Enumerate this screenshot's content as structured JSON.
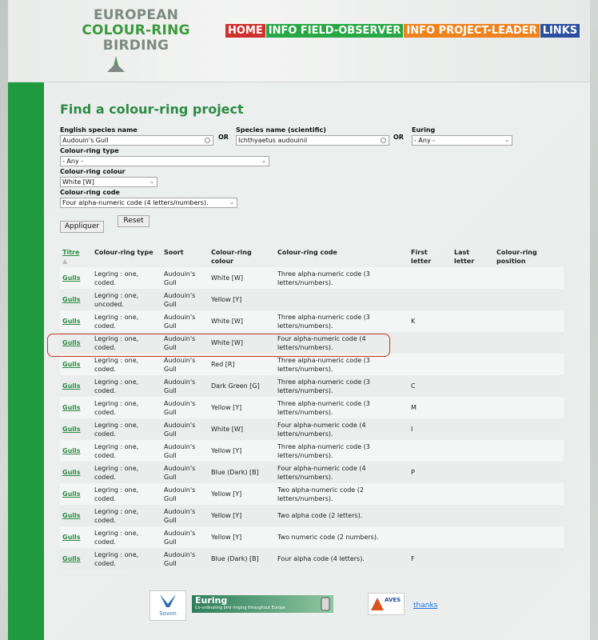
{
  "logo": {
    "line1": "EUROPEAN",
    "line2": "COLOUR-RING",
    "line3": "BIRDING"
  },
  "nav": [
    {
      "label": "HOME",
      "color": "#d0312d"
    },
    {
      "label": "INFO FIELD-OBSERVER",
      "color": "#28a745"
    },
    {
      "label": "INFO PROJECT-LEADER",
      "color": "#f0821e"
    },
    {
      "label": "LINKS",
      "color": "#2b4fa0"
    }
  ],
  "page_title": "Find a colour-ring project",
  "form": {
    "english_label": "English species name",
    "english_value": "Audouin's Gull",
    "or1": "OR",
    "scientific_label": "Species name (scientific)",
    "scientific_value": "Ichthyaetus audouinii",
    "or2": "OR",
    "euring_label": "Euring",
    "euring_value": "- Any -",
    "ringtype_label": "Colour-ring type",
    "ringtype_value": "- Any -",
    "ringcolour_label": "Colour-ring colour",
    "ringcolour_value": "White [W]",
    "ringcode_label": "Colour-ring code",
    "ringcode_value": "Four alpha-numeric code (4 letters/numbers).",
    "apply_label": "Appliquer",
    "reset_label": "Reset"
  },
  "table": {
    "headers": {
      "titre": "Titre",
      "type": "Colour-ring type",
      "soort": "Soort",
      "colour": "Colour-ring colour",
      "code": "Colour-ring code",
      "first": "First letter",
      "last": "Last letter",
      "position": "Colour-ring position"
    },
    "rows": [
      {
        "titre": "Gulls",
        "type": "Legring : one, coded.",
        "soort": "Audouin's Gull",
        "colour": "White [W]",
        "code": "Three alpha-numeric code (3 letters/numbers).",
        "first": ""
      },
      {
        "titre": "Gulls",
        "type": "Legring : one, uncoded.",
        "soort": "Audouin's Gull",
        "colour": "Yellow [Y]",
        "code": "",
        "first": ""
      },
      {
        "titre": "Gulls",
        "type": "Legring : one, coded.",
        "soort": "Audouin's Gull",
        "colour": "White [W]",
        "code": "Three alpha-numeric code (3 letters/numbers).",
        "first": "K"
      },
      {
        "titre": "Gulls",
        "type": "Legring : one, coded.",
        "soort": "Audouin's Gull",
        "colour": "White [W]",
        "code": "Four alpha-numeric code (4 letters/numbers).",
        "first": ""
      },
      {
        "titre": "Gulls",
        "type": "Legring : one, coded.",
        "soort": "Audouin's Gull",
        "colour": "Red [R]",
        "code": "Three alpha-numeric code (3 letters/numbers).",
        "first": ""
      },
      {
        "titre": "Gulls",
        "type": "Legring : one, coded.",
        "soort": "Audouin's Gull",
        "colour": "Dark Green [G]",
        "code": "Three alpha-numeric code (3 letters/numbers).",
        "first": "C"
      },
      {
        "titre": "Gulls",
        "type": "Legring : one, coded.",
        "soort": "Audouin's Gull",
        "colour": "Yellow [Y]",
        "code": "Three alpha-numeric code (3 letters/numbers).",
        "first": "M"
      },
      {
        "titre": "Gulls",
        "type": "Legring : one, coded.",
        "soort": "Audouin's Gull",
        "colour": "White [W]",
        "code": "Four alpha-numeric code (4 letters/numbers).",
        "first": "I"
      },
      {
        "titre": "Gulls",
        "type": "Legring : one, coded.",
        "soort": "Audouin's Gull",
        "colour": "Yellow [Y]",
        "code": "Three alpha-numeric code (3 letters/numbers).",
        "first": ""
      },
      {
        "titre": "Gulls",
        "type": "Legring : one, coded.",
        "soort": "Audouin's Gull",
        "colour": "Blue (Dark) [B]",
        "code": "Four alpha-numeric code (4 letters/numbers).",
        "first": "P"
      },
      {
        "titre": "Gulls",
        "type": "Legring : one, coded.",
        "soort": "Audouin's Gull",
        "colour": "Yellow [Y]",
        "code": "Two alpha-numeric code (2 letters/numbers).",
        "first": ""
      },
      {
        "titre": "Gulls",
        "type": "Legring : one, coded.",
        "soort": "Audouin's Gull",
        "colour": "Yellow [Y]",
        "code": "Two alpha code (2 letters).",
        "first": ""
      },
      {
        "titre": "Gulls",
        "type": "Legring : one, coded.",
        "soort": "Audouin's Gull",
        "colour": "Yellow [Y]",
        "code": "Two numeric code (2 numbers).",
        "first": ""
      },
      {
        "titre": "Gulls",
        "type": "Legring : one, coded.",
        "soort": "Audouin's Gull",
        "colour": "Blue (Dark) [B]",
        "code": "Four alpha code (4 letters).",
        "first": "F"
      }
    ]
  },
  "footer": {
    "sovon": "Sovon",
    "euring_title": "Euring",
    "euring_sub": "Co-ordinating bird ringing throughout Europe",
    "aves": "AVES",
    "thanks": "thanks"
  }
}
